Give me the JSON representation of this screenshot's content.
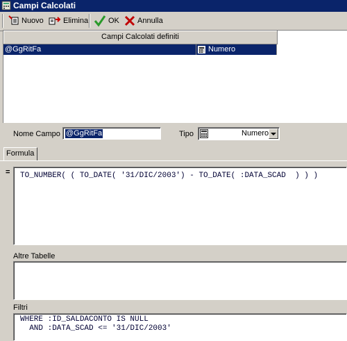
{
  "window": {
    "title": "Campi Calcolati"
  },
  "toolbar": {
    "new_label": "Nuovo",
    "delete_label": "Elimina",
    "ok_label": "OK",
    "cancel_label": "Annulla"
  },
  "grid": {
    "header": "Campi Calcolati definiti",
    "rows": [
      {
        "name": "@GgRitFa",
        "type": "Numero"
      }
    ]
  },
  "fields": {
    "name_label": "Nome Campo",
    "name_value": "@GgRitFa",
    "type_label": "Tipo",
    "type_value": "Numero"
  },
  "tabs": [
    {
      "label": "Formula"
    }
  ],
  "formula": {
    "prefix": "=",
    "text": "TO_NUMBER( ( TO_DATE( '31/DIC/2003') - TO_DATE( :DATA_SCAD  ) ) )"
  },
  "other_tables": {
    "label": "Altre Tabelle",
    "text": ""
  },
  "filters": {
    "label": "Filtri",
    "line1": "WHERE :ID_SALDACONTO IS NULL",
    "line2": "  AND :DATA_SCAD <= '31/DIC/2003'"
  }
}
